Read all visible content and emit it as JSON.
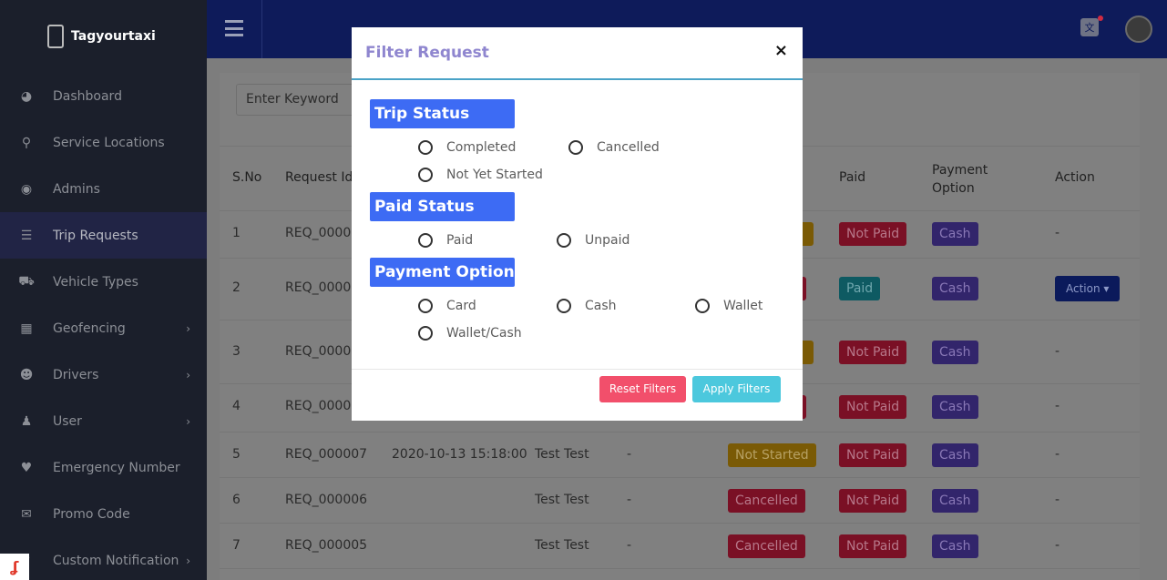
{
  "app": {
    "brand": "Tagyourtaxi"
  },
  "sidebar": {
    "items": [
      {
        "label": "Dashboard",
        "icon": "dashboard-icon"
      },
      {
        "label": "Service Locations",
        "icon": "location-pin-icon"
      },
      {
        "label": "Admins",
        "icon": "user-circle-icon"
      },
      {
        "label": "Trip Requests",
        "icon": "list-icon",
        "active": true
      },
      {
        "label": "Vehicle Types",
        "icon": "taxi-icon"
      },
      {
        "label": "Geofencing",
        "icon": "map-icon",
        "chevron": true
      },
      {
        "label": "Drivers",
        "icon": "users-icon",
        "chevron": true
      },
      {
        "label": "User",
        "icon": "user-icon",
        "chevron": true
      },
      {
        "label": "Emergency Number",
        "icon": "heartbeat-icon"
      },
      {
        "label": "Promo Code",
        "icon": "gift-icon"
      },
      {
        "label": "Custom Notification",
        "icon": "bell-icon",
        "chevron": true
      }
    ]
  },
  "search": {
    "placeholder": "Enter Keyword"
  },
  "table": {
    "headers": {
      "sno": "S.No",
      "request_id": "Request Id",
      "paid": "Paid",
      "payment_option_1": "Payment",
      "payment_option_2": "Option",
      "action": "Action"
    },
    "rows": [
      {
        "sno": "1",
        "req": "REQ_0000",
        "date": "",
        "user": "",
        "driver": "",
        "status": "",
        "paid": "Not Paid",
        "payment": "Cash",
        "action": "-"
      },
      {
        "sno": "2",
        "req": "REQ_0000",
        "date": "",
        "user": "",
        "driver": "",
        "status": "",
        "paid": "Paid",
        "payment": "Cash",
        "action": "Action"
      },
      {
        "sno": "3",
        "req": "REQ_0000",
        "date": "",
        "user": "",
        "driver": "",
        "status": "",
        "paid": "Not Paid",
        "payment": "Cash",
        "action": "-"
      },
      {
        "sno": "4",
        "req": "REQ_0000",
        "date": "",
        "user": "",
        "driver": "",
        "status": "",
        "paid": "Not Paid",
        "payment": "Cash",
        "action": "-"
      },
      {
        "sno": "5",
        "req": "REQ_000007",
        "date": "2020-10-13 15:18:00",
        "user": "Test Test",
        "driver": "-",
        "status": "Not Started",
        "paid": "Not Paid",
        "payment": "Cash",
        "action": "-"
      },
      {
        "sno": "6",
        "req": "REQ_000006",
        "date": "",
        "user": "Test Test",
        "driver": "-",
        "status": "Cancelled",
        "paid": "Not Paid",
        "payment": "Cash",
        "action": "-"
      },
      {
        "sno": "7",
        "req": "REQ_000005",
        "date": "",
        "user": "Test Test",
        "driver": "-",
        "status": "Cancelled",
        "paid": "Not Paid",
        "payment": "Cash",
        "action": "-"
      }
    ]
  },
  "modal": {
    "title": "Filter Request",
    "close": "×",
    "sections": {
      "trip_status": {
        "label": "Trip Status",
        "options": [
          "Completed",
          "Cancelled",
          "Not Yet Started"
        ]
      },
      "paid_status": {
        "label": "Paid Status",
        "options": [
          "Paid",
          "Unpaid"
        ]
      },
      "payment_option": {
        "label": "Payment Option",
        "options": [
          "Card",
          "Cash",
          "Wallet",
          "Wallet/Cash"
        ]
      }
    },
    "reset_label": "Reset Filters",
    "apply_label": "Apply Filters"
  },
  "colors": {
    "topbar": "#0e1b5a",
    "section_label": "#3d6bf4",
    "reset": "#f24f6b",
    "apply": "#4cc8dd",
    "modal_title": "#8f86cf"
  }
}
